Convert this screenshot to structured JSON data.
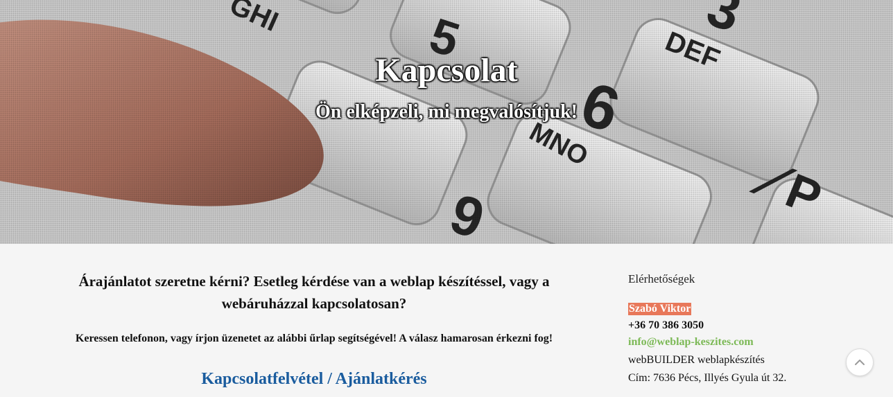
{
  "hero": {
    "title": "Kapcsolat",
    "subtitle": "Ön elképzeli, mi megvalósítjuk!"
  },
  "main": {
    "heading": "Árajánlatot szeretne kérni? Esetleg kérdése van a weblap készítéssel, vagy a webáruházzal kapcsolatosan?",
    "text": "Keressen telefonon, vagy írjon üzenetet az alábbi űrlap segítségével! A válasz hamarosan érkezni fog!",
    "form_title": "Kapcsolatfelvétel / Ajánlatkérés"
  },
  "sidebar": {
    "heading": "Elérhetőségek",
    "name": "Szabó Viktor",
    "phone": "+36 70 386 3050",
    "email": "info@weblap-keszites.com",
    "company": "webBUILDER weblapkészítés",
    "address": "Cím: 7636 Pécs, Illyés Gyula út 32."
  },
  "colors": {
    "accent": "#e8785a",
    "link": "#7cb956",
    "form_title": "#1a5c9e"
  },
  "icons": {
    "scroll_top": "chevron-up-icon"
  }
}
